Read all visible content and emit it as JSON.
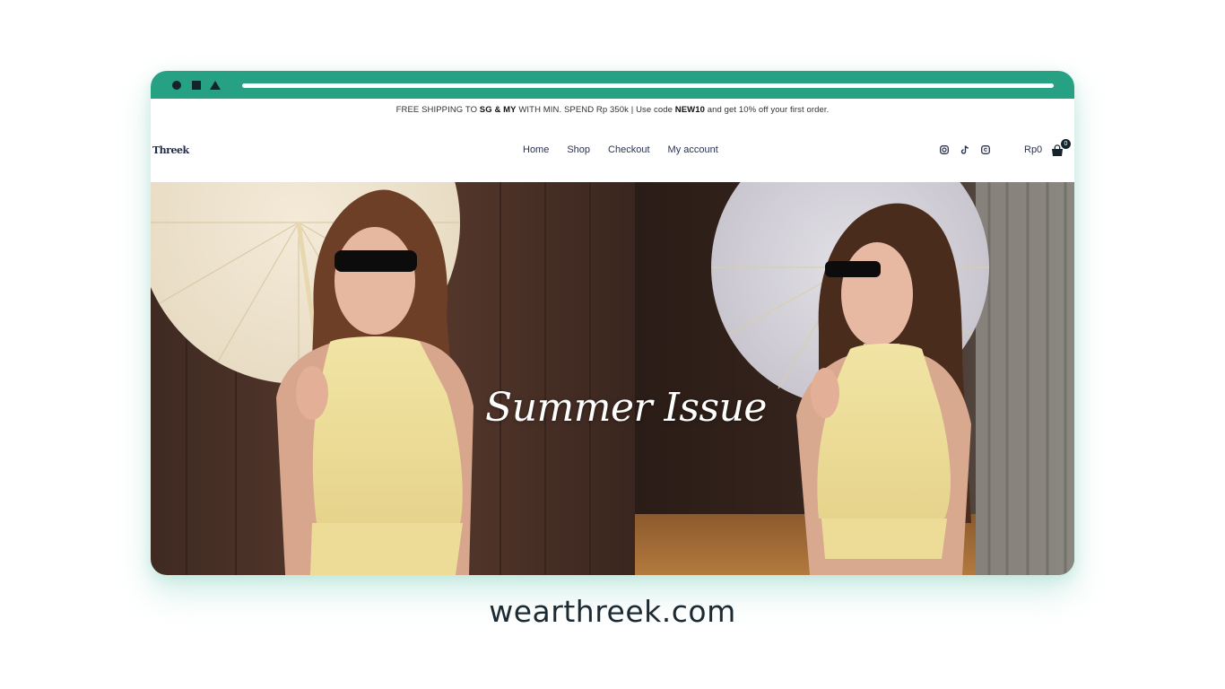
{
  "announcement": {
    "part1": "FREE SHIPPING TO ",
    "bold1": "SG & MY",
    "part2": " WITH MIN. SPEND Rp 350k | Use code ",
    "bold2": "NEW10",
    "part3": " and get 10% off your first order."
  },
  "header": {
    "logo_text": "Threek",
    "nav": [
      "Home",
      "Shop",
      "Checkout",
      "My account"
    ],
    "social_icons": [
      "instagram-icon",
      "tiktok-icon",
      "threads-icon"
    ],
    "cart_total": "Rp0",
    "cart_count": "0"
  },
  "hero": {
    "title": "Summer Issue"
  },
  "caption": "wearthreek.com",
  "colors": {
    "chrome_bar": "#26a184",
    "chrome_icons": "#15242b",
    "nav_text": "#2a3350",
    "caption": "#1b2a33"
  }
}
